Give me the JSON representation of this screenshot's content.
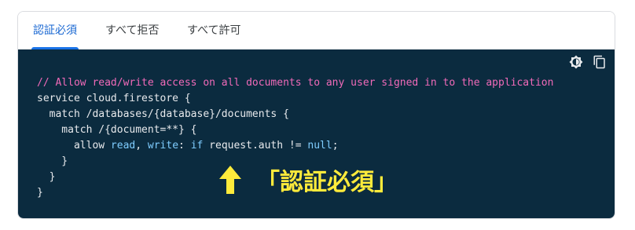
{
  "tabs": [
    {
      "label": "認証必須",
      "active": true
    },
    {
      "label": "すべて拒否",
      "active": false
    },
    {
      "label": "すべて許可",
      "active": false
    }
  ],
  "toolbar": {
    "theme_icon": "dark-mode-icon",
    "copy_icon": "copy-icon"
  },
  "code": {
    "line1": "// Allow read/write access on all documents to any user signed in to the application",
    "line2": "service cloud.firestore {",
    "line3": "  match /databases/{database}/documents {",
    "line4": "    match /{document=**} {",
    "line5_indent": "      allow ",
    "line5_read": "read",
    "line5_comma": ", ",
    "line5_write": "write",
    "line5_colon": ": ",
    "line5_if": "if",
    "line5_mid": " request.auth != ",
    "line5_null": "null",
    "line5_end": ";",
    "line6": "    }",
    "line7": "  }",
    "line8": "}"
  },
  "annotation": {
    "text": "「認証必須」",
    "arrow_icon": "up-arrow-icon",
    "color": "#ffeb3b"
  },
  "colors": {
    "code_background": "#0b2b3f",
    "comment": "#f16ab9",
    "keyword": "#7fcdff",
    "active_tab": "#1967d2"
  }
}
